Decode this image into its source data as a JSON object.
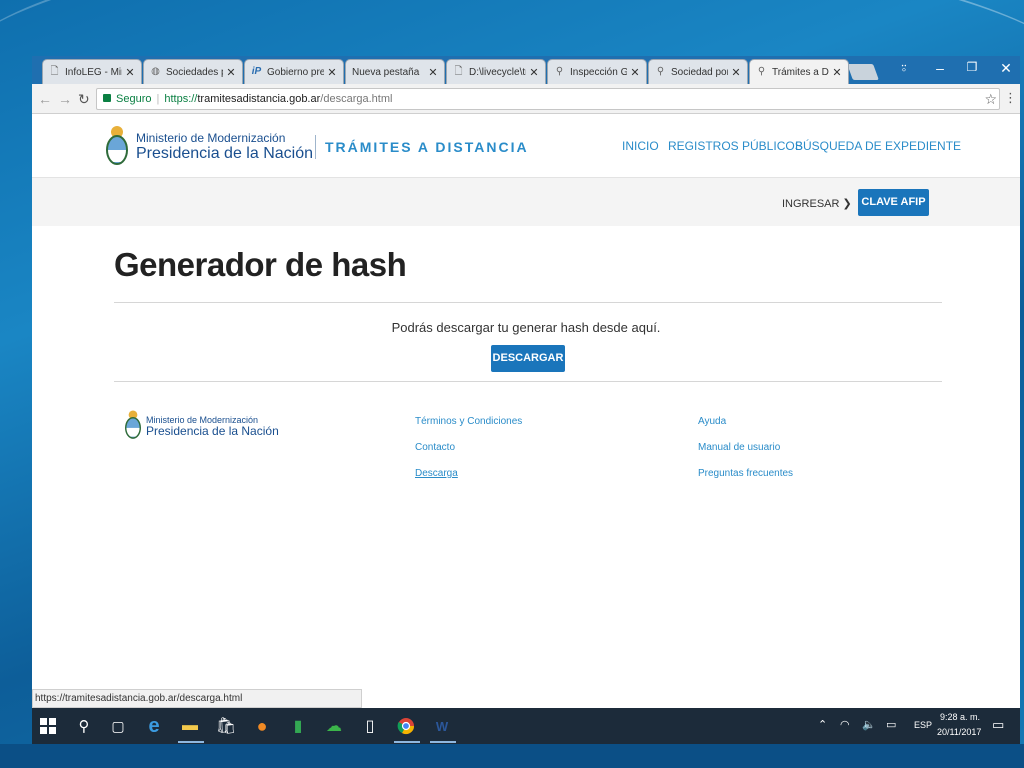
{
  "tabs": [
    {
      "title": "InfoLEG - Mini",
      "icon": "document-icon"
    },
    {
      "title": "Sociedades po",
      "icon": "globe-icon"
    },
    {
      "title": "Gobierno pret",
      "icon": "ip-icon"
    },
    {
      "title": "Nueva pestaña",
      "icon": "blank-icon"
    },
    {
      "title": "D:\\livecycle\\tra",
      "icon": "document-icon"
    },
    {
      "title": "Inspección Ge",
      "icon": "argentina-seal-icon"
    },
    {
      "title": "Sociedad por a",
      "icon": "argentina-seal-icon"
    },
    {
      "title": "Trámites a Dist",
      "icon": "argentina-seal-icon",
      "active": true
    }
  ],
  "address_bar": {
    "secure_label": "Seguro",
    "url_scheme": "https://",
    "url_host": "tramitesadistancia.gob.ar",
    "url_path": "/descarga.html"
  },
  "header": {
    "ministry": "Ministerio de Modernización",
    "presidency": "Presidencia de la Nación",
    "site_name": "TRÁMITES A DISTANCIA",
    "nav": [
      "INICIO",
      "REGISTROS PÚBLICOS",
      "BÚSQUEDA DE EXPEDIENTE"
    ],
    "login_label": "INGRESAR",
    "clave_label": "CLAVE AFIP"
  },
  "main": {
    "title": "Generador de hash",
    "intro": "Podrás descargar tu generar hash desde aquí.",
    "download_label": "DESCARGAR"
  },
  "footer": {
    "ministry": "Ministerio de Modernización",
    "presidency": "Presidencia de la Nación",
    "col1": [
      "Términos y Condiciones",
      "Contacto",
      "Descarga"
    ],
    "col2": [
      "Ayuda",
      "Manual de usuario",
      "Preguntas frecuentes"
    ]
  },
  "status_bar_url": "https://tramitesadistancia.gob.ar/descarga.html",
  "taskbar": {
    "language": "ESP",
    "time": "9:28 a. m.",
    "date": "20/11/2017"
  },
  "colors": {
    "accent_blue": "#1a75bb",
    "link_blue": "#2a8cc9",
    "brand_navy": "#1a4f8f"
  }
}
